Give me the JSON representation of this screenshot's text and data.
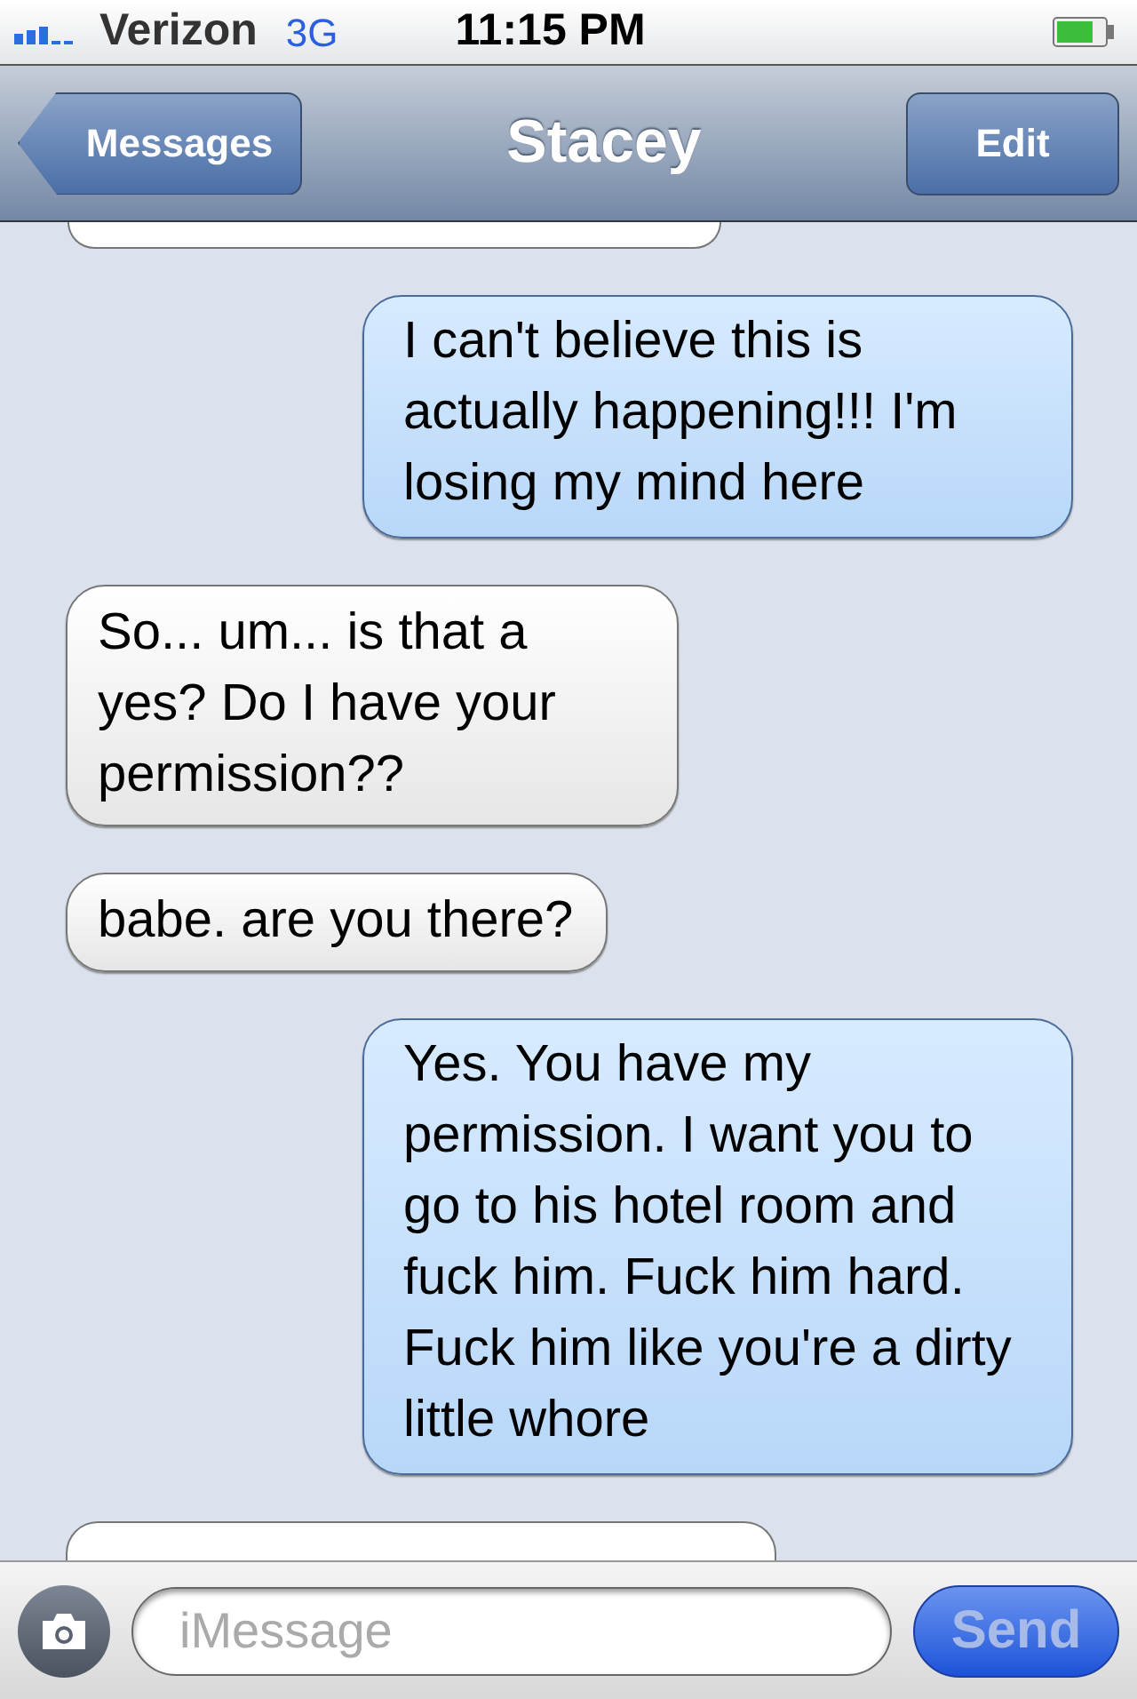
{
  "status_bar": {
    "carrier": "Verizon",
    "network": "3G",
    "time": "11:15 PM"
  },
  "nav": {
    "back": "Messages",
    "title": "Stacey",
    "edit": "Edit"
  },
  "messages": [
    {
      "kind": "peek_top"
    },
    {
      "kind": "sent",
      "text": "I can't believe this is actually happening!!! I'm losing my mind here"
    },
    {
      "kind": "received",
      "text": "So... um... is that a yes? Do I have your permission??"
    },
    {
      "kind": "received",
      "text": "babe. are you there?"
    },
    {
      "kind": "sent",
      "text": "Yes. You have my permission. I want you to go to his hotel room and fuck him. Fuck him hard. Fuck him like you're a dirty little whore"
    },
    {
      "kind": "peek_bottom"
    }
  ],
  "composer": {
    "placeholder": "iMessage",
    "send": "Send",
    "send_disabled": true
  }
}
